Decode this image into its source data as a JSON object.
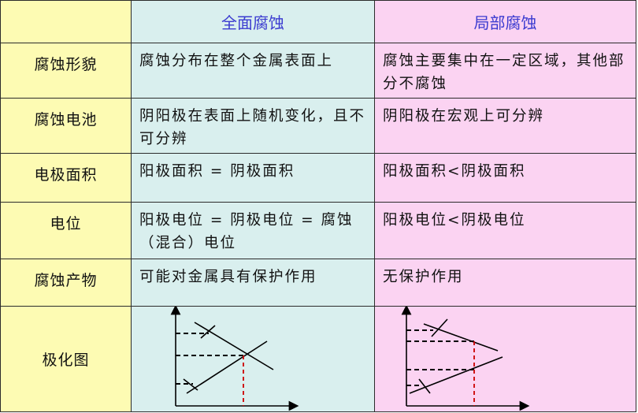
{
  "header": {
    "col_uniform": "全面腐蚀",
    "col_local": "局部腐蚀"
  },
  "rows": [
    {
      "label": "腐蚀形貌",
      "uniform": "腐蚀分布在整个金属表面上",
      "local": "腐蚀主要集中在一定区域，其他部分不腐蚀"
    },
    {
      "label": "腐蚀电池",
      "uniform": "阴阳极在表面上随机变化，且不可分辨",
      "local": "阴阳极在宏观上可分辨"
    },
    {
      "label": "电极面积",
      "uniform": "阳极面积 = 阴极面积",
      "local": "阳极面积<阴极面积"
    },
    {
      "label": "电位",
      "uniform": "阳极电位 = 阴极电位 = 腐蚀（混合）电位",
      "local": "阳极电位<阴极电位"
    },
    {
      "label": "腐蚀产物",
      "uniform": "可能对金属具有保护作用",
      "local": "无保护作用"
    },
    {
      "label": "极化图"
    }
  ],
  "colors": {
    "label_column": "#fdfbb3",
    "uniform_column": "#d9efee",
    "local_column": "#fbd3f2",
    "header_text": "#3b3bd0",
    "guide_line": "#cc0000"
  }
}
